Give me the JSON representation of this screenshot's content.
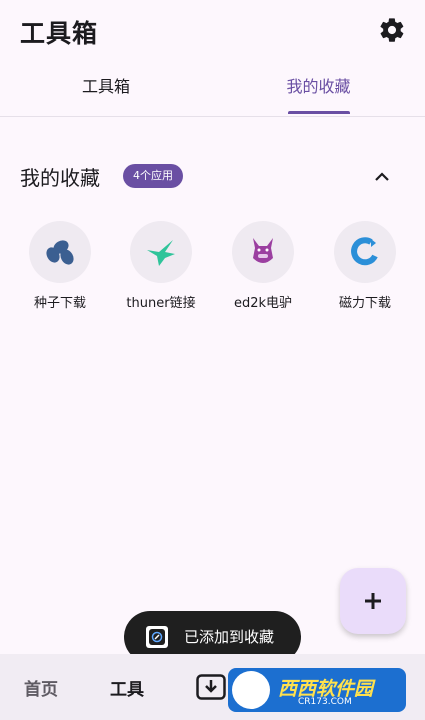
{
  "header": {
    "title": "工具箱",
    "settings_icon": "gear-icon"
  },
  "tabs": [
    {
      "label": "工具箱",
      "selected": false
    },
    {
      "label": "我的收藏",
      "selected": true
    }
  ],
  "favorites": {
    "title": "我的收藏",
    "badge": "4个应用",
    "collapse_icon": "chevron-up-icon",
    "apps": [
      {
        "label": "种子下载",
        "icon": "seeds-icon",
        "color": "#3b5f91"
      },
      {
        "label": "thuner链接",
        "icon": "hummingbird-icon",
        "color": "#2fc49a"
      },
      {
        "label": "ed2k电驴",
        "icon": "donkey-icon",
        "color": "#9b3fa0"
      },
      {
        "label": "磁力下载",
        "icon": "magnet-icon",
        "color": "#2b8fd8"
      }
    ]
  },
  "fab": {
    "icon": "plus-icon"
  },
  "snackbar": {
    "text": "已添加到收藏"
  },
  "bottom_nav": {
    "home": "首页",
    "tools": "工具",
    "download_icon": "download-icon"
  },
  "watermark": {
    "brand": "西西软件园",
    "site": "CR173.COM"
  },
  "colors": {
    "accent": "#6a4fa3",
    "background": "#fdf7fd"
  }
}
